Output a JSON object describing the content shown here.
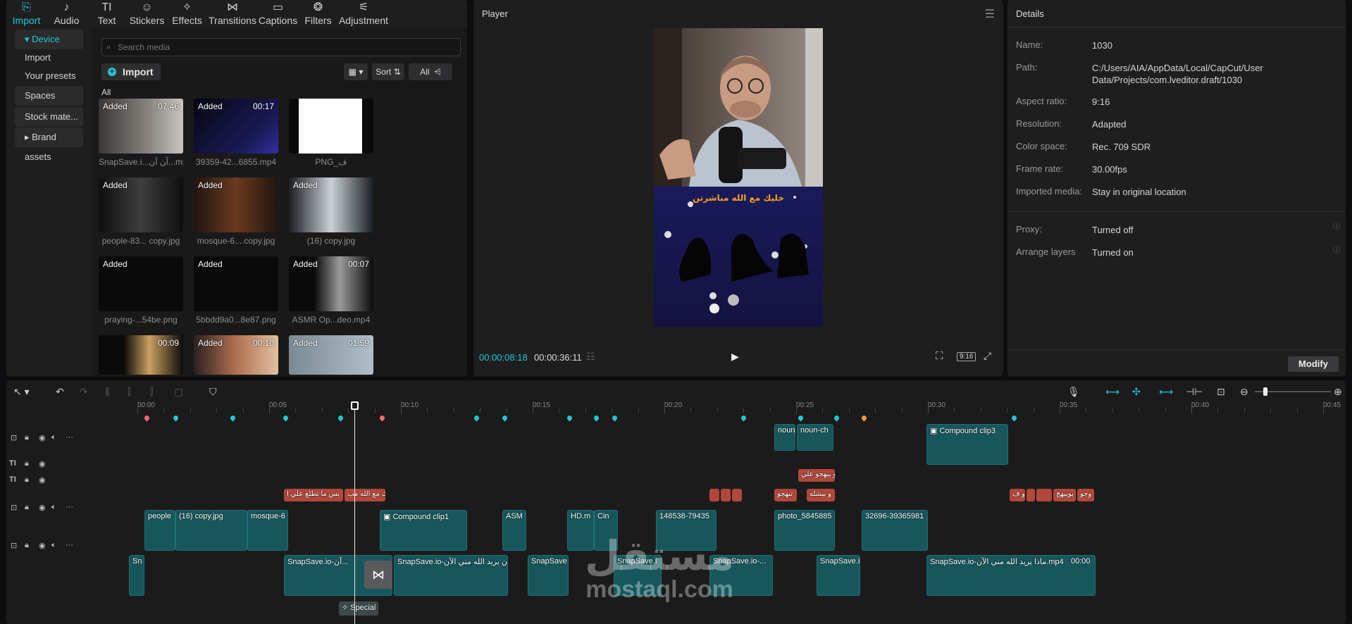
{
  "media_tabs": [
    {
      "label": "Import",
      "icon": "import-icon",
      "glyph": "⎘"
    },
    {
      "label": "Audio",
      "icon": "audio-icon",
      "glyph": "♪"
    },
    {
      "label": "Text",
      "icon": "text-icon",
      "glyph": "TI"
    },
    {
      "label": "Stickers",
      "icon": "stickers-icon",
      "glyph": "☺"
    },
    {
      "label": "Effects",
      "icon": "effects-icon",
      "glyph": "✧"
    },
    {
      "label": "Transitions",
      "icon": "transitions-icon",
      "glyph": "⋈"
    },
    {
      "label": "Captions",
      "icon": "captions-icon",
      "glyph": "▭"
    },
    {
      "label": "Filters",
      "icon": "filters-icon",
      "glyph": "❂"
    },
    {
      "label": "Adjustment",
      "icon": "adjustment-icon",
      "glyph": "⚟"
    }
  ],
  "sidebar": {
    "device": "Device",
    "import": "Import",
    "presets": "Your presets",
    "spaces": "Spaces",
    "stock": "Stock mate...",
    "brand": "Brand assets"
  },
  "media": {
    "search_placeholder": "Search media",
    "import_label": "Import",
    "sort_label": "Sort",
    "filter_label": "All",
    "all_label": "All",
    "items": [
      {
        "name": "SnapSave.i...آن أن...mp4",
        "added": "Added",
        "duration": "07:46"
      },
      {
        "name": "39359-42...6855.mp4",
        "added": "Added",
        "duration": "00:17"
      },
      {
        "name": "PNG_ف",
        "added": "",
        "duration": ""
      },
      {
        "name": "people-83... copy.jpg",
        "added": "Added",
        "duration": ""
      },
      {
        "name": "mosque-6....copy.jpg",
        "added": "Added",
        "duration": ""
      },
      {
        "name": "(16) copy.jpg",
        "added": "Added",
        "duration": ""
      },
      {
        "name": "praying-...54be.png",
        "added": "Added",
        "duration": ""
      },
      {
        "name": "5bbdd9a0...8e87.png",
        "added": "Added",
        "duration": ""
      },
      {
        "name": "ASMR Op...deo.mp4",
        "added": "Added",
        "duration": "00:07"
      },
      {
        "name": "",
        "added": "",
        "duration": "00:09"
      },
      {
        "name": "",
        "added": "Added",
        "duration": "00:10"
      },
      {
        "name": "",
        "added": "Added",
        "duration": "01:59"
      }
    ]
  },
  "player": {
    "title": "Player",
    "current_time": "00:00:08:18",
    "total_time": "00:00:36:11",
    "ratio": "9:16",
    "overlay_text": "خليك مع الله مباشرتن"
  },
  "details": {
    "title": "Details",
    "rows": [
      {
        "k": "Name:",
        "v": "1030"
      },
      {
        "k": "Path:",
        "v": "C:/Users/AIA/AppData/Local/CapCut/User Data/Projects/com.lveditor.draft/1030"
      },
      {
        "k": "Aspect ratio:",
        "v": "9:16"
      },
      {
        "k": "Resolution:",
        "v": "Adapted"
      },
      {
        "k": "Color space:",
        "v": "Rec. 709 SDR"
      },
      {
        "k": "Frame rate:",
        "v": "30.00fps"
      },
      {
        "k": "Imported media:",
        "v": "Stay in original location"
      },
      {
        "k": "Proxy:",
        "v": "Turned off"
      },
      {
        "k": "Arrange layers",
        "v": "Turned on"
      }
    ],
    "modify_label": "Modify"
  },
  "timeline": {
    "ruler": [
      "00:00",
      "00:05",
      "00:10",
      "00:15",
      "00:20",
      "00:25",
      "00:30",
      "00:35",
      "00:40",
      "00:45"
    ],
    "clips": {
      "c1": "noun",
      "c2": "noun-ch",
      "c3": "Compound clip3",
      "c4": "و يبهجو علي",
      "c5": "بس ما تطلع علي ا",
      "c6": "خليك مع الله مب",
      "c7": "تبهجو",
      "c8": "و بيشله",
      "c9": "و ف",
      "c10": "بويبهج",
      "c11": "وجو",
      "c12": "people",
      "c13": "(16) copy.jpg",
      "c14": "mosque-6",
      "c15": "Compound clip1",
      "c16": "ASM",
      "c17": "HD.m",
      "c18": "Cin",
      "c19": "148538-79435",
      "c20": "photo_5845885",
      "c21": "32696-39365981",
      "c22": "Sn",
      "c23": "SnapSave.io-آن...",
      "c24": "SnapSave.io-آن بريد الله مني الآن",
      "c25": "SnapSave.",
      "c26": "SnapSave.i",
      "c27": "SnapSave.io-...",
      "c28": "SnapSave.i",
      "c29": "SnapSave.io-ماذا يريد الله مني الآن.mp4",
      "c30": "00:00",
      "c31": "Special"
    }
  },
  "watermark": {
    "ar": "مستقل",
    "en": "mostaql.com"
  },
  "colors": {
    "accent": "#22c7d6",
    "text_clip": "#b2473b",
    "video_clip": "#17575c"
  }
}
